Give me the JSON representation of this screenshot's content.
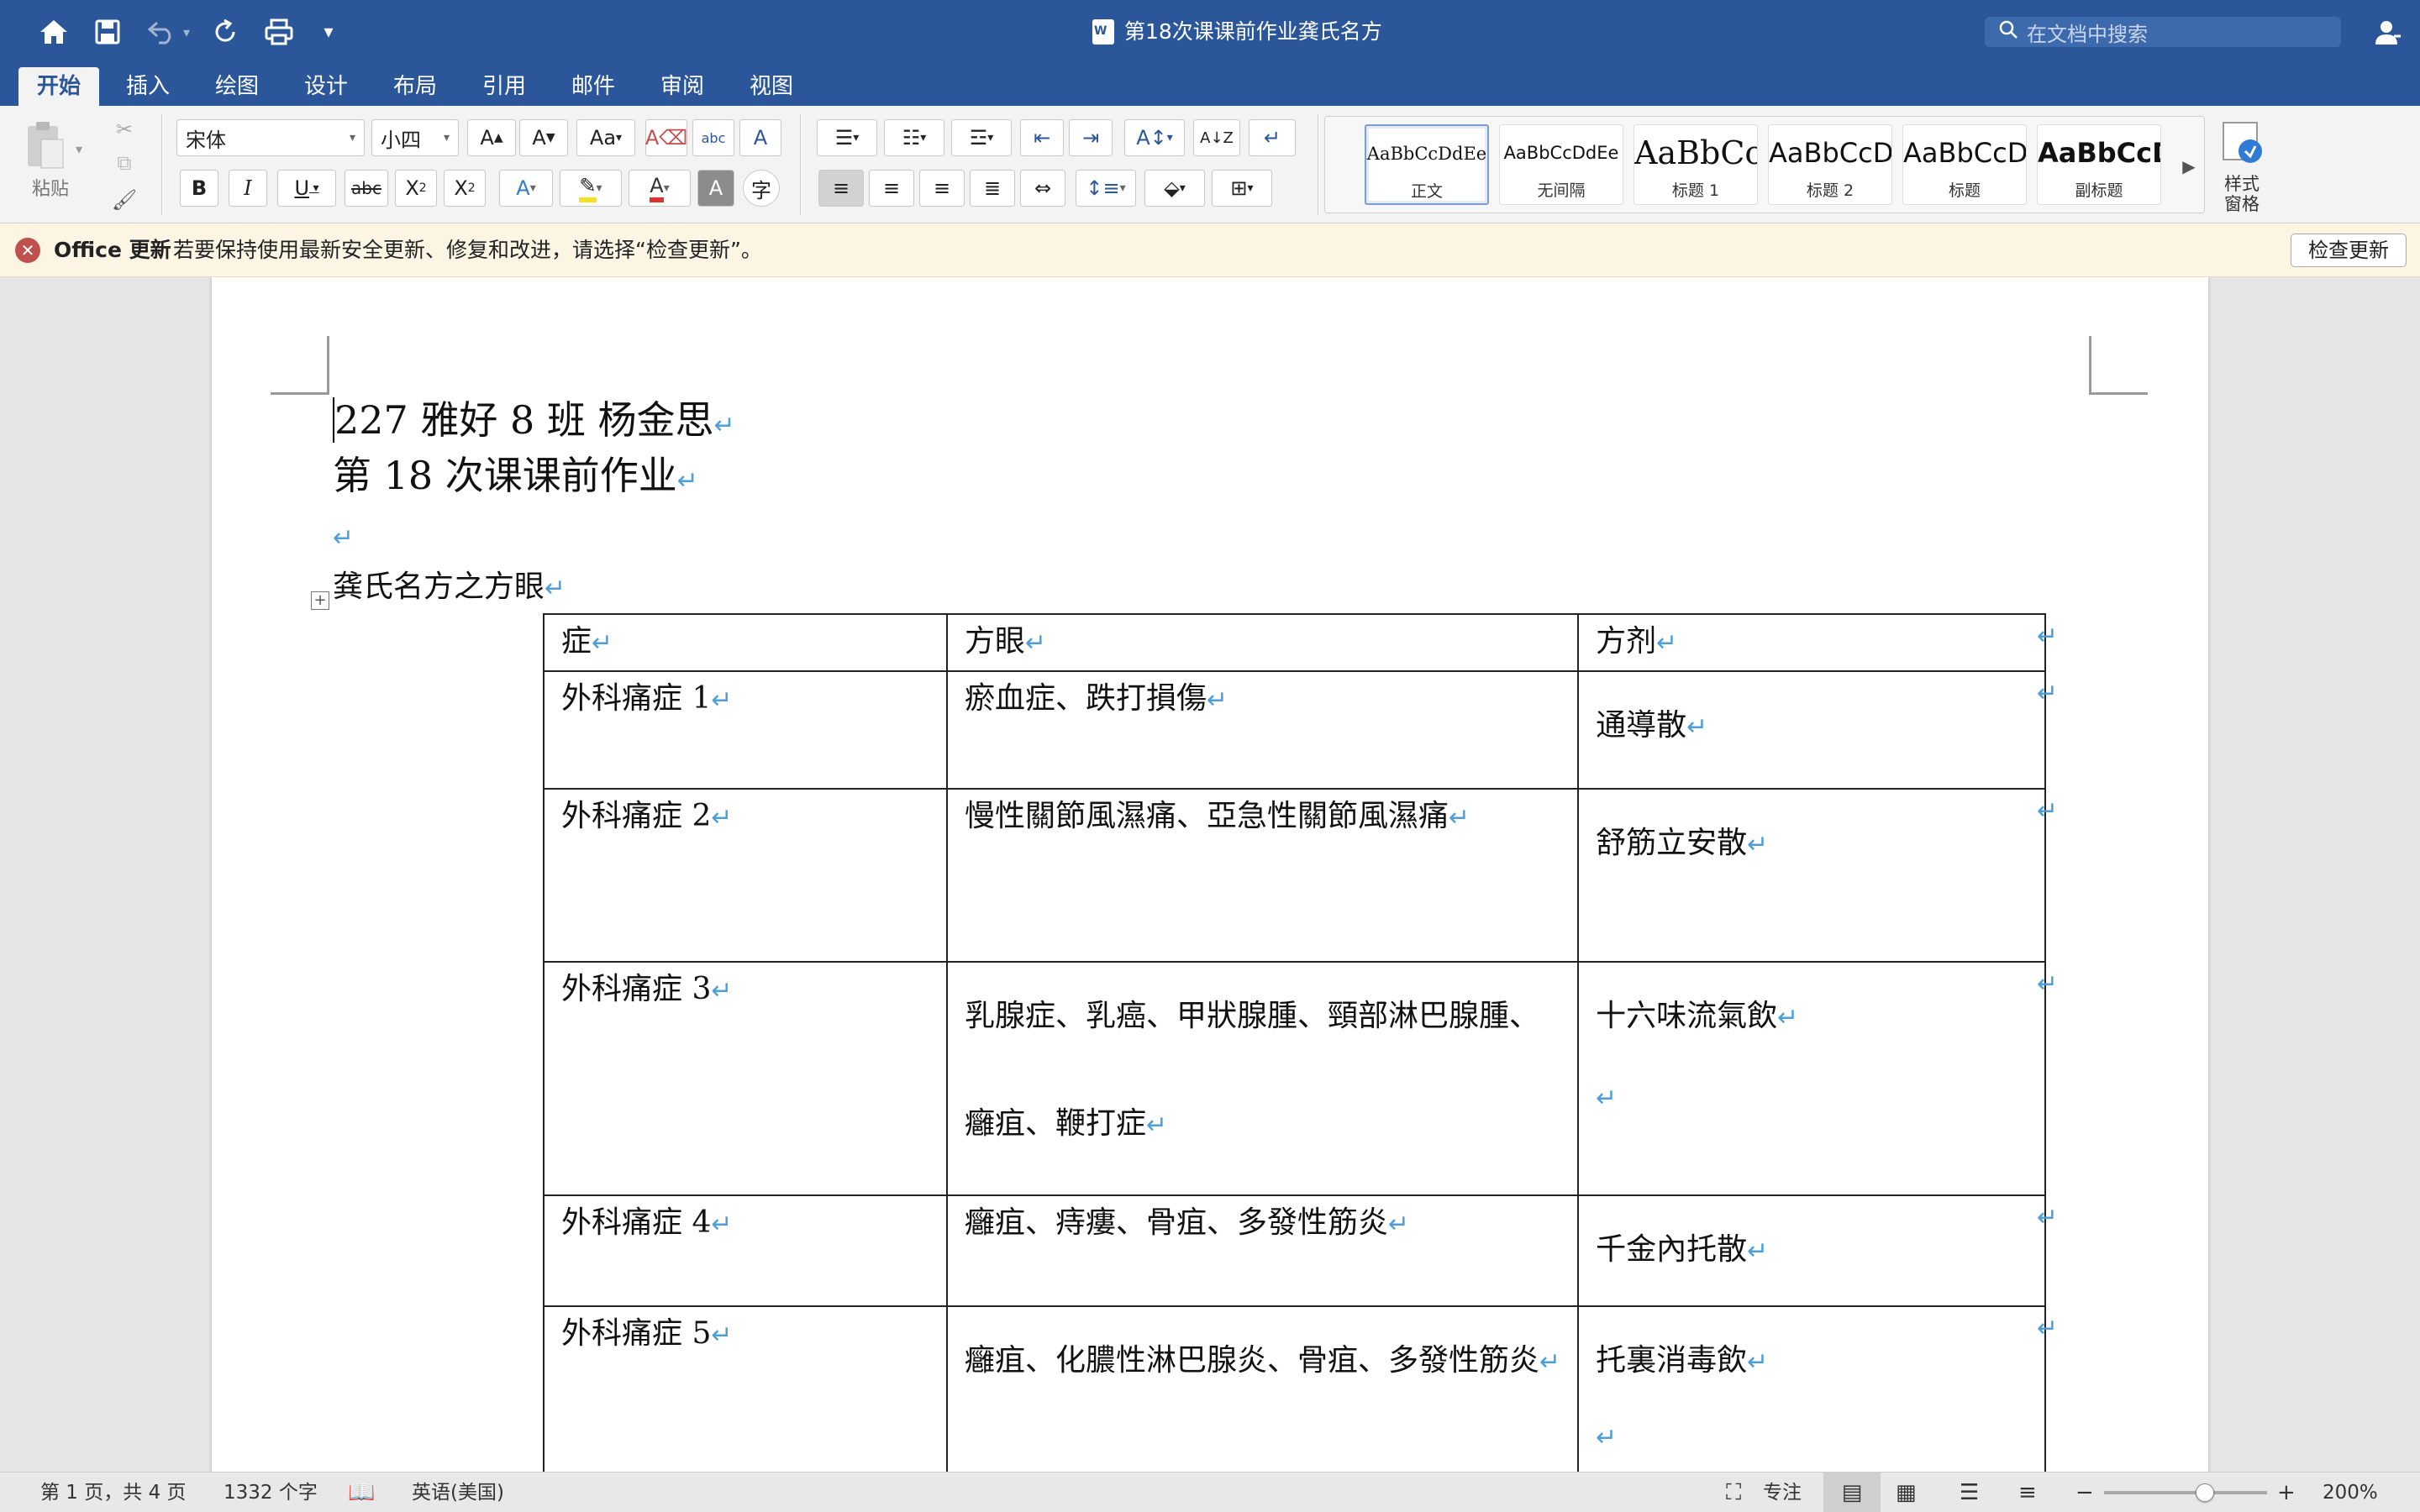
{
  "titlebar": {
    "doc_title": "第18次课课前作业龚氏名方",
    "search_placeholder": "在文档中搜索"
  },
  "tabs": [
    {
      "label": "开始",
      "active": true
    },
    {
      "label": "插入"
    },
    {
      "label": "绘图"
    },
    {
      "label": "设计"
    },
    {
      "label": "布局"
    },
    {
      "label": "引用"
    },
    {
      "label": "邮件"
    },
    {
      "label": "审阅"
    },
    {
      "label": "视图"
    }
  ],
  "share_label": "共享",
  "ribbon": {
    "paste_label": "粘贴",
    "font_name": "宋体",
    "font_size": "小四",
    "styles": [
      {
        "preview": "AaBbCcDdEe",
        "label": "正文"
      },
      {
        "preview": "AaBbCcDdEe",
        "label": "无间隔"
      },
      {
        "preview": "AaBbCc",
        "label": "标题 1"
      },
      {
        "preview": "AaBbCcD",
        "label": "标题 2"
      },
      {
        "preview": "AaBbCcD",
        "label": "标题"
      },
      {
        "preview": "AaBbCcD",
        "label": "副标题"
      }
    ],
    "styles_pane_label_1": "样式",
    "styles_pane_label_2": "窗格"
  },
  "notification": {
    "title": "Office 更新",
    "message": "若要保持使用最新安全更新、修复和改进，请选择“检查更新”。",
    "button": "检查更新"
  },
  "document": {
    "line1": "227 雅好 8 班  杨金思",
    "line2": "第 18 次课课前作业",
    "caption": "龚氏名方之方眼",
    "table": {
      "headers": [
        "症",
        "方眼",
        "方剂"
      ],
      "rows": [
        {
          "a": "外科痛症 1",
          "b": [
            "瘀血症、跌打損傷"
          ],
          "c": [
            "通導散"
          ]
        },
        {
          "a": "外科痛症 2",
          "b": [
            "慢性關節風濕痛、亞急性關節風濕痛"
          ],
          "c": [
            "舒筋立安散"
          ]
        },
        {
          "a": "外科痛症 3",
          "b": [
            "乳腺症、乳癌、甲狀腺腫、頸部淋巴腺腫、",
            "癰疽、鞭打症"
          ],
          "c": [
            "十六味流氣飲"
          ]
        },
        {
          "a": "外科痛症 4",
          "b": [
            "癰疽、痔瘻、骨疽、多發性筋炎"
          ],
          "c": [
            "千金內托散"
          ]
        },
        {
          "a": "外科痛症 5",
          "b": [
            "癰疽、化膿性淋巴腺炎、骨疽、多發性筋炎"
          ],
          "c": [
            "托裏消毒飲"
          ]
        }
      ]
    }
  },
  "status": {
    "page": "第 1 页，共 4 页",
    "words": "1332 个字",
    "language": "英语(美国)",
    "focus": "专注",
    "zoom": "200%",
    "zoom_level": 0.62
  }
}
